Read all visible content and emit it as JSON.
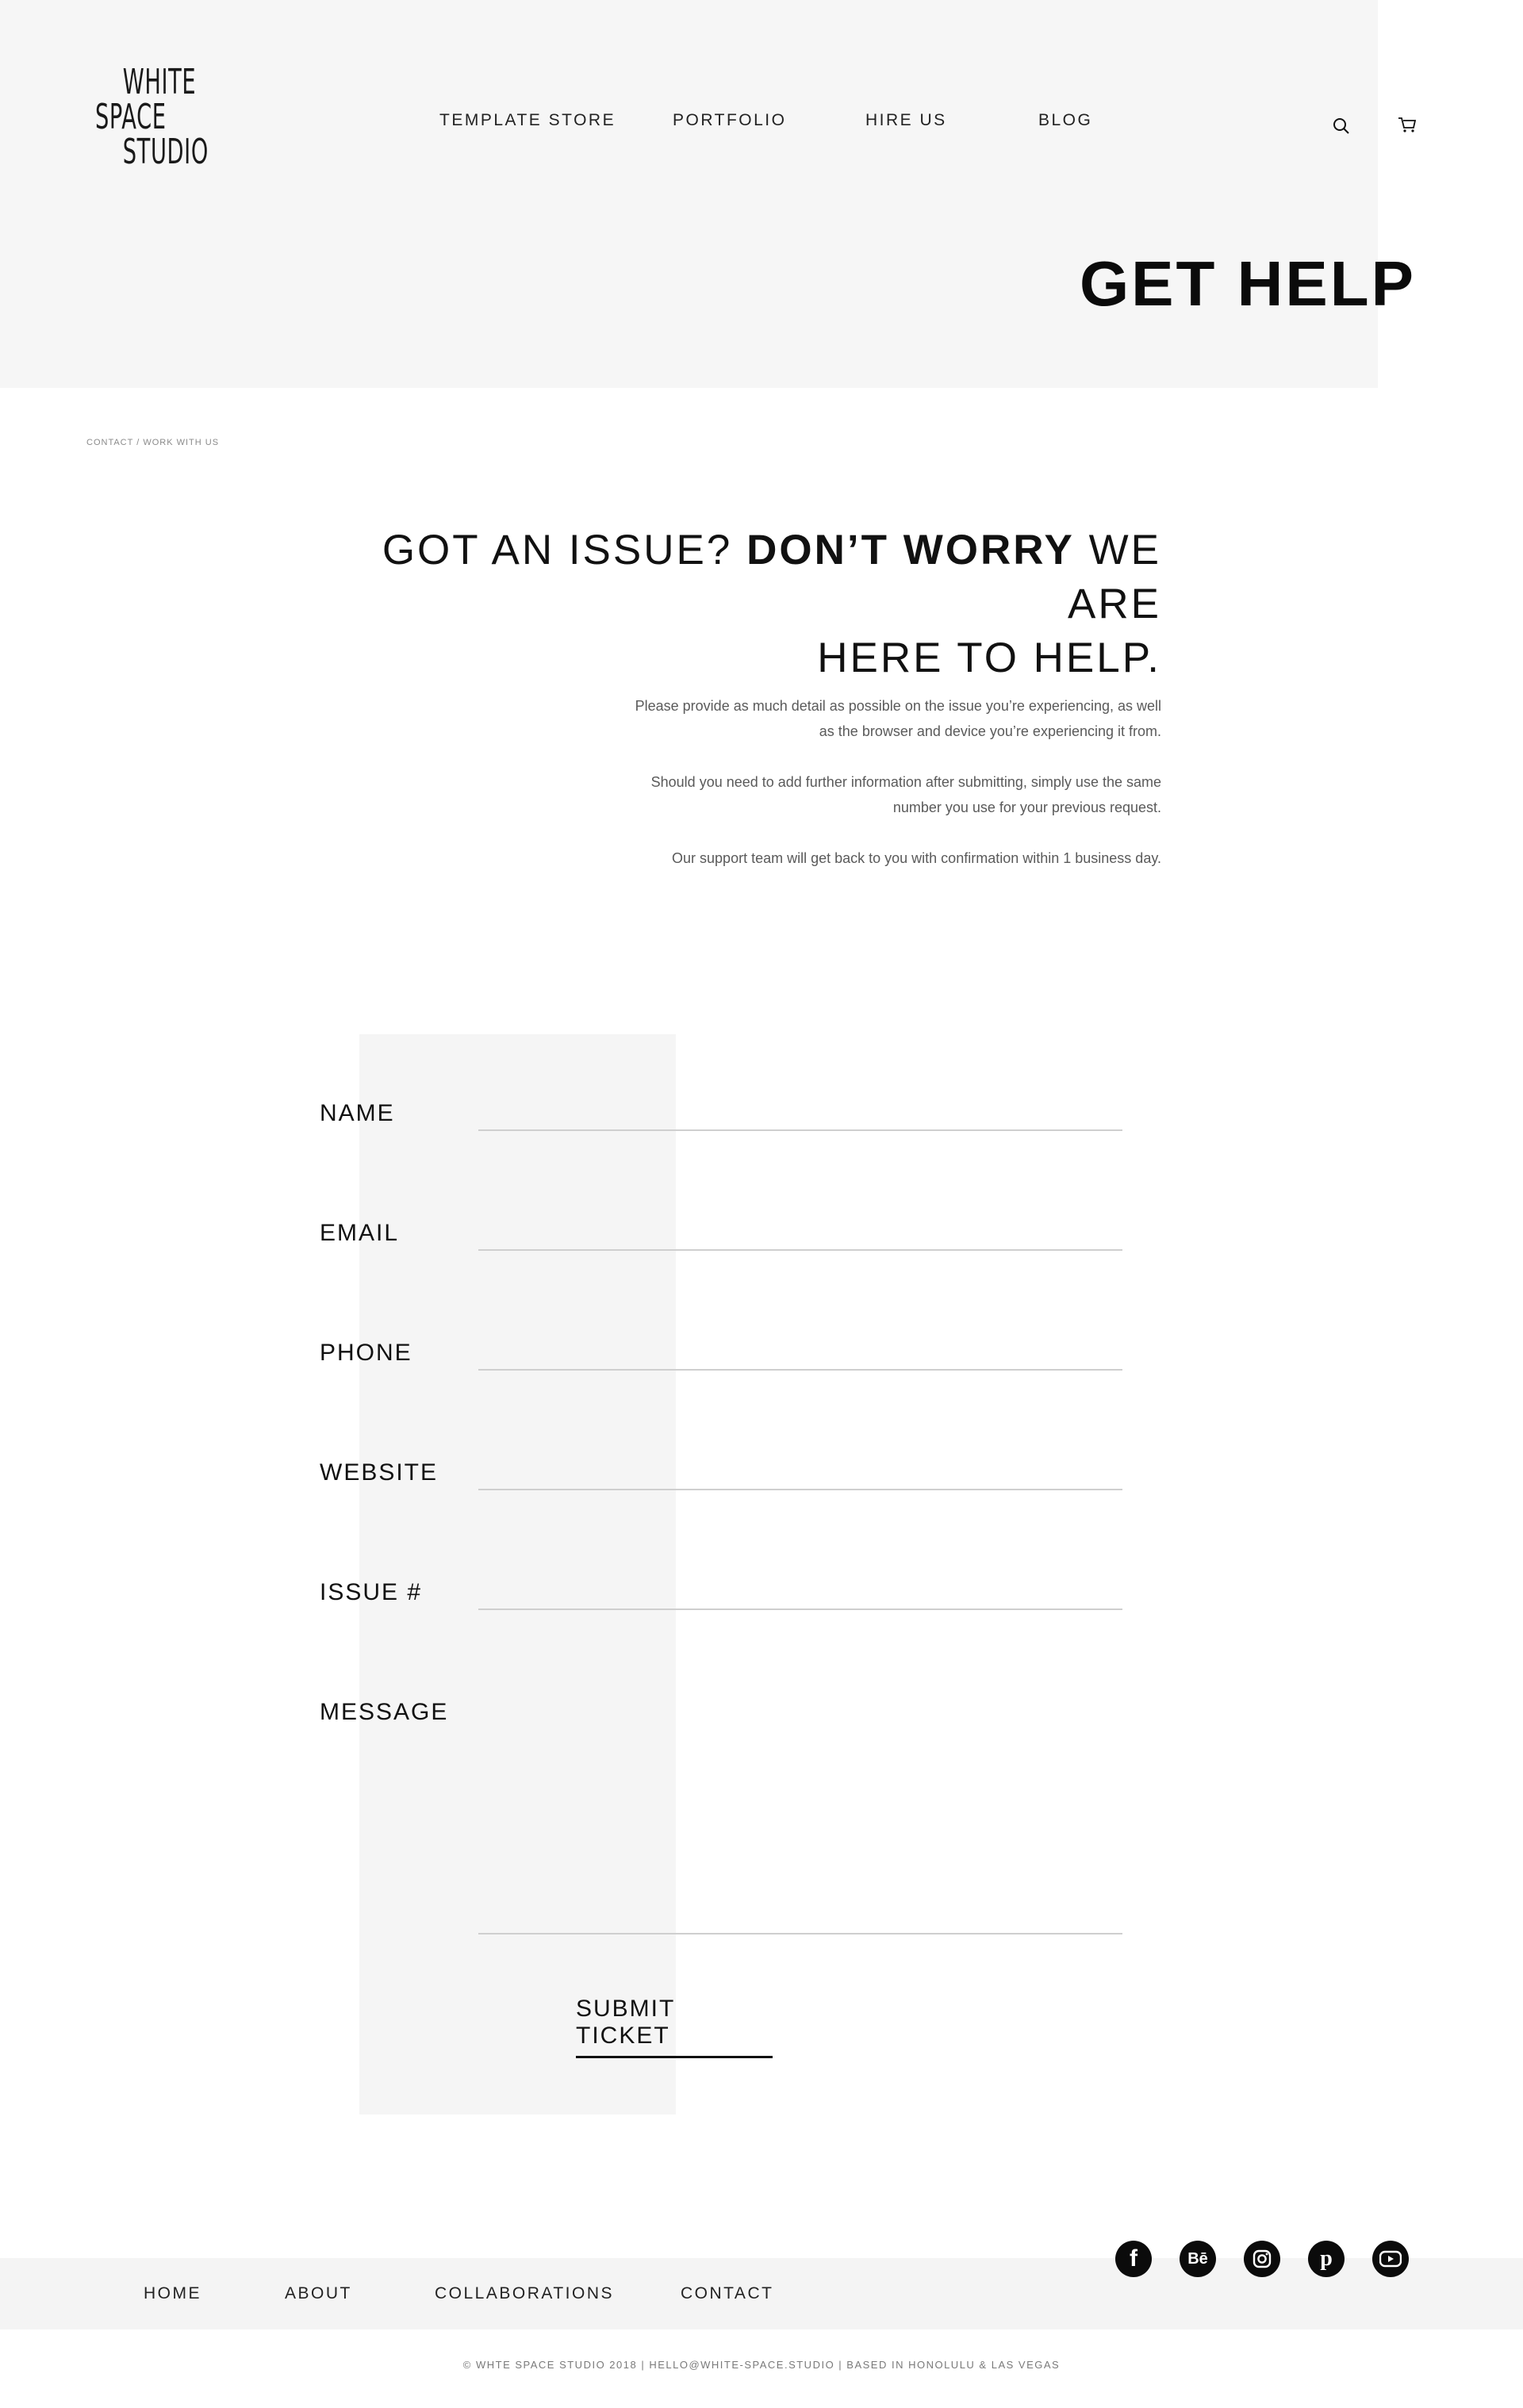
{
  "brand": {
    "logo_lines": [
      "WHITE",
      "SPACE",
      "STUDIO"
    ]
  },
  "nav": {
    "items": [
      "TEMPLATE STORE",
      "PORTFOLIO",
      "HIRE US",
      "BLOG"
    ],
    "search_icon": "search-icon",
    "cart_icon": "cart-icon"
  },
  "hero": {
    "title": "GET HELP"
  },
  "breadcrumb": "CONTACT / WORK WITH US",
  "headline": {
    "part1": "GOT AN ISSUE? ",
    "bold": "DON’T WORRY",
    "part2": " WE ARE",
    "line2": "HERE TO HELP."
  },
  "intro": {
    "p1": "Please provide as much detail as possible on the issue you’re experiencing, as well as the browser and device you’re experiencing it from.",
    "p2": "Should you need to add further information after submitting, simply use the same number you use for your previous request.",
    "p3": "Our support team will get back to you with confirmation within 1 business day."
  },
  "form": {
    "fields": [
      {
        "label": "NAME",
        "value": ""
      },
      {
        "label": "EMAIL",
        "value": ""
      },
      {
        "label": "PHONE",
        "value": ""
      },
      {
        "label": "WEBSITE",
        "value": ""
      },
      {
        "label": "ISSUE #",
        "value": ""
      },
      {
        "label": "MESSAGE",
        "value": ""
      }
    ],
    "submit_label": "SUBMIT TICKET"
  },
  "social": [
    "facebook-icon",
    "behance-icon",
    "instagram-icon",
    "pinterest-icon",
    "youtube-icon"
  ],
  "footer": {
    "nav": [
      "HOME",
      "ABOUT",
      "COLLABORATIONS",
      "CONTACT"
    ],
    "copyright": "© WHTE SPACE STUDIO 2018 |  HELLO@WHITE-SPACE.STUDIO |   BASED IN HONOLULU & LAS VEGAS"
  }
}
